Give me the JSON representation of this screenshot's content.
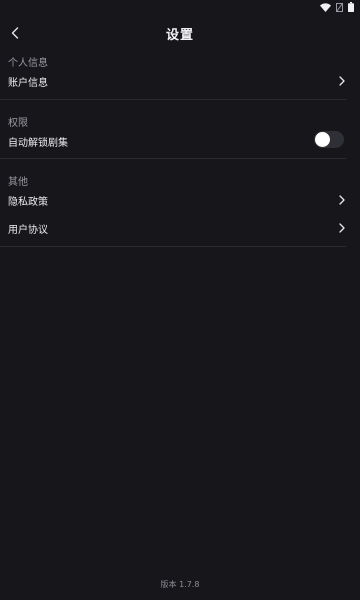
{
  "header": {
    "title": "设置"
  },
  "sections": [
    {
      "title": "个人信息",
      "items": [
        {
          "label": "账户信息",
          "type": "link"
        }
      ]
    },
    {
      "title": "权限",
      "items": [
        {
          "label": "自动解锁剧集",
          "type": "toggle",
          "enabled": false
        }
      ]
    },
    {
      "title": "其他",
      "items": [
        {
          "label": "隐私政策",
          "type": "link"
        },
        {
          "label": "用户协议",
          "type": "link"
        }
      ]
    }
  ],
  "footer": {
    "version": "版本 1.7.8"
  },
  "status_bar": {
    "icons": [
      "wifi-icon",
      "signal-icon",
      "battery-icon"
    ]
  },
  "colors": {
    "background": "#16161b",
    "divider": "#2a2a31",
    "section_title": "#9a9aa3",
    "text": "#ececf0",
    "toggle_track": "#2f2f36",
    "toggle_knob": "#ffffff"
  }
}
